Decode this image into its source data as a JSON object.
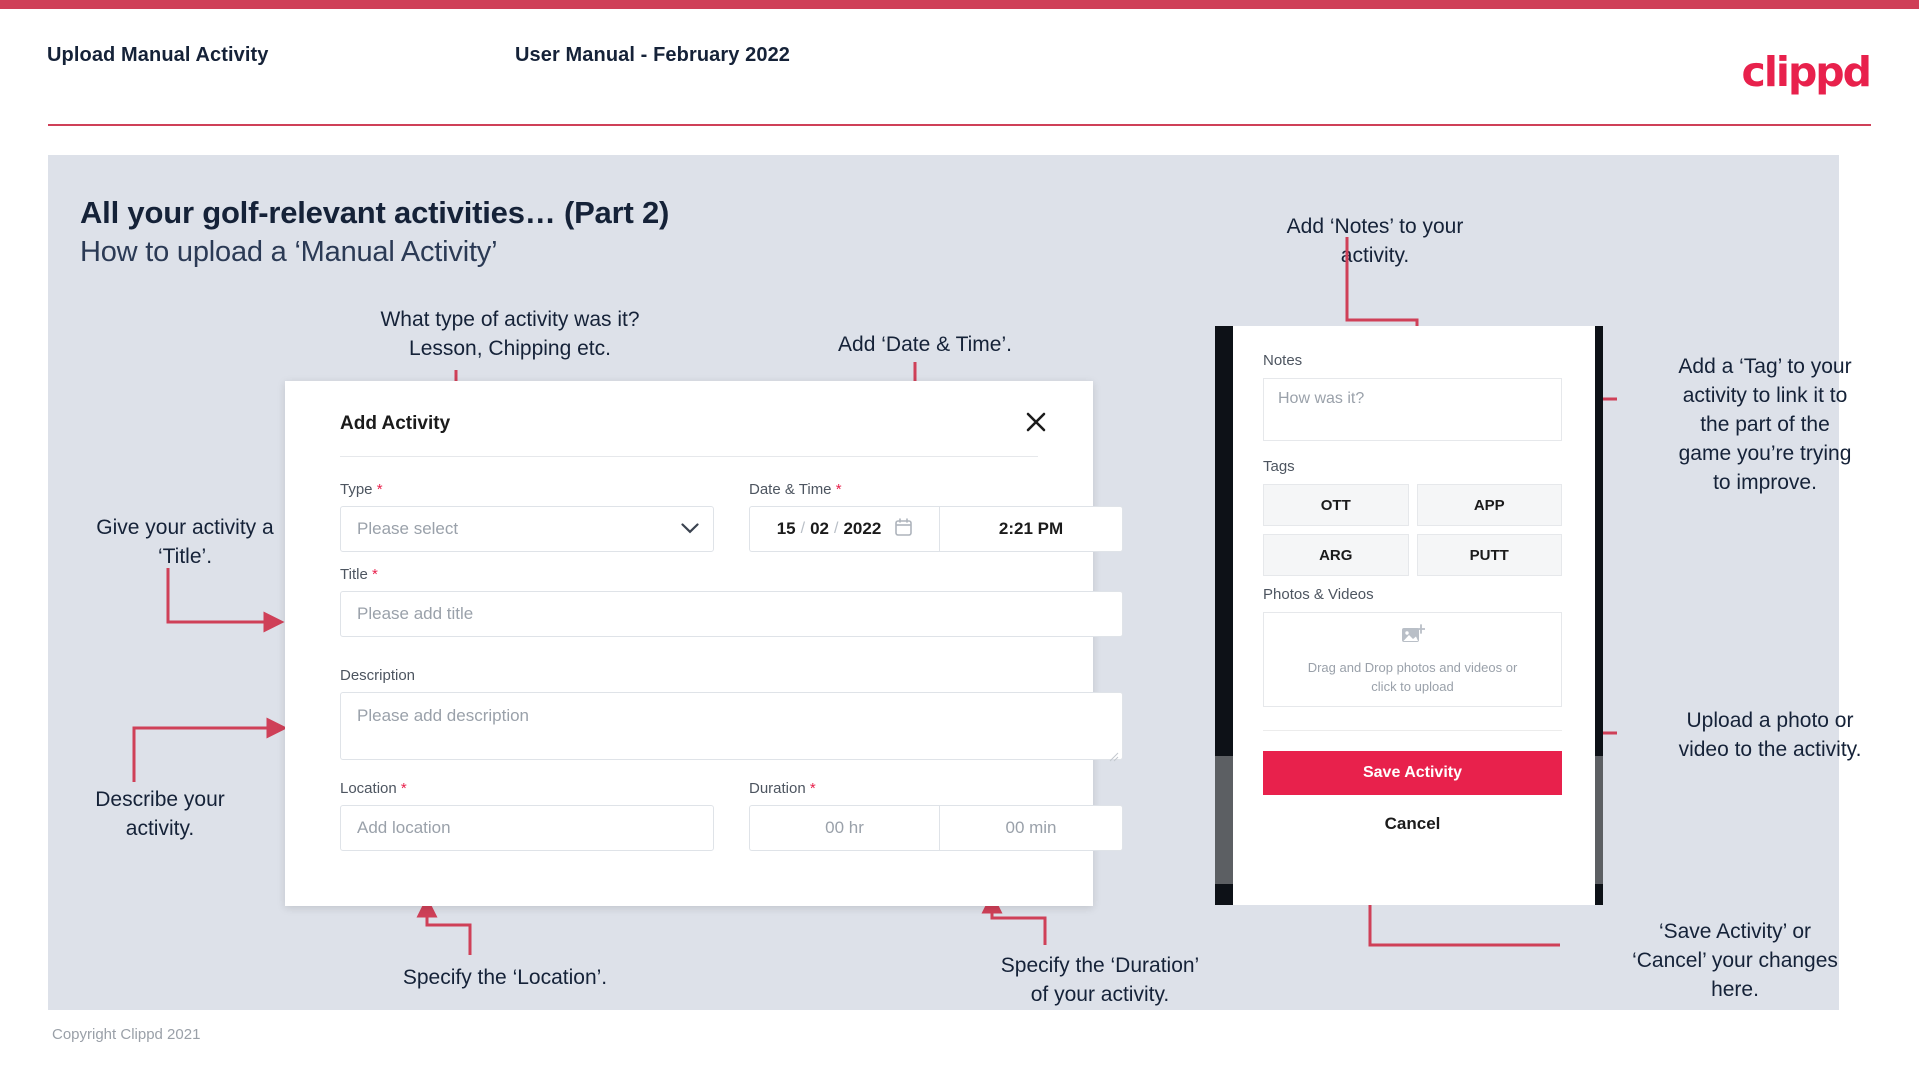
{
  "header": {
    "title": "Upload Manual Activity",
    "subtitle": "User Manual - February 2022",
    "logo": "clippd"
  },
  "slide": {
    "title_main": "All your golf-relevant activities… (Part 2)",
    "title_sub": "How to upload a ‘Manual Activity’"
  },
  "footer": {
    "copyright": "Copyright Clippd 2021"
  },
  "annotations": {
    "type": "What type of activity was it?\nLesson, Chipping etc.",
    "datetime": "Add ‘Date & Time’.",
    "title": "Give your activity a\n‘Title’.",
    "description": "Describe your\nactivity.",
    "location": "Specify the ‘Location’.",
    "duration": "Specify the ‘Duration’\nof your activity.",
    "notes": "Add ‘Notes’ to your\nactivity.",
    "tags": "Add a ‘Tag’ to your\nactivity to link it to\nthe part of the\ngame you’re trying\nto improve.",
    "upload": "Upload a photo or\nvideo to the activity.",
    "save": "‘Save Activity’ or\n‘Cancel’ your changes\nhere."
  },
  "dialog": {
    "title": "Add Activity",
    "close_icon": "close-icon",
    "fields": {
      "type": {
        "label": "Type",
        "required": "*",
        "placeholder": "Please select"
      },
      "datetime": {
        "label": "Date & Time",
        "required": "*",
        "day": "15",
        "month": "02",
        "year": "2022",
        "sep1": "/",
        "sep2": "/",
        "time": "2:21 PM"
      },
      "title": {
        "label": "Title",
        "required": "*",
        "placeholder": "Please add title"
      },
      "description": {
        "label": "Description",
        "required": "",
        "placeholder": "Please add description"
      },
      "location": {
        "label": "Location",
        "required": "*",
        "placeholder": "Add location"
      },
      "duration": {
        "label": "Duration",
        "required": "*",
        "hours": "00 hr",
        "minutes": "00 min"
      }
    }
  },
  "phone": {
    "notes_label": "Notes",
    "notes_placeholder": "How was it?",
    "tags_label": "Tags",
    "tags": [
      "OTT",
      "APP",
      "ARG",
      "PUTT"
    ],
    "photos_label": "Photos & Videos",
    "drop_text": "Drag and Drop photos and videos or\nclick to upload",
    "save_label": "Save Activity",
    "cancel_label": "Cancel"
  },
  "colors": {
    "brand_pink": "#e8214c",
    "accent_rule": "#cf4058",
    "slide_bg": "#dde1e9",
    "text_dark": "#152238"
  }
}
